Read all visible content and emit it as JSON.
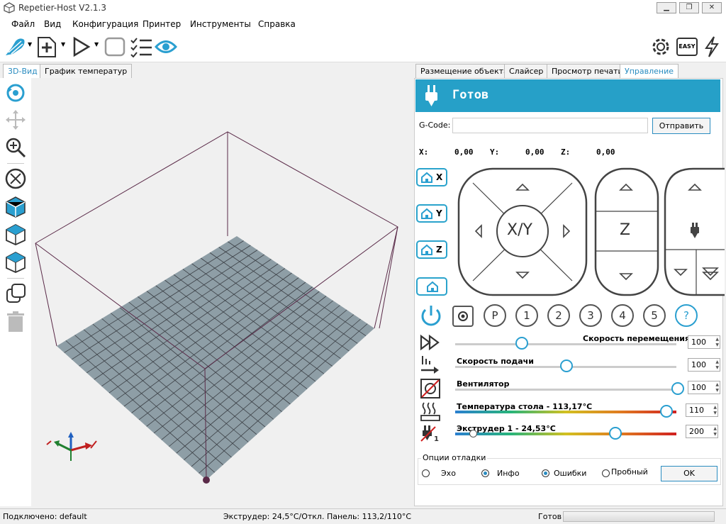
{
  "window": {
    "title": "Repetier-Host V2.1.3",
    "minimize": "▁",
    "maximize": "❐",
    "close": "✕"
  },
  "menu": [
    "Файл",
    "Вид",
    "Конфигурация",
    "Принтер",
    "Инструменты",
    "Справка"
  ],
  "left_tabs": [
    "3D-Вид",
    "График температур"
  ],
  "right_tabs": [
    "Размещение объекта",
    "Слайсер",
    "Просмотр печати",
    "Управление"
  ],
  "toolbar": {
    "easy_label": "EASY"
  },
  "control": {
    "status": "Готов",
    "gcode_label": "G-Code:",
    "gcode_value": "",
    "send_button": "Отправить",
    "coords": {
      "x_label": "X:",
      "x": "0,00",
      "y_label": "Y:",
      "y": "0,00",
      "z_label": "Z:",
      "z": "0,00"
    },
    "home_x": "X",
    "home_y": "Y",
    "home_z": "Z",
    "xy_label": "X/Y",
    "z_label": "Z",
    "presets": [
      "P",
      "1",
      "2",
      "3",
      "4",
      "5",
      "?"
    ]
  },
  "sliders": {
    "move_speed": {
      "label": "Скорость перемещения",
      "value": "100",
      "level": 0.3
    },
    "feed_speed": {
      "label": "Скорость подачи",
      "value": "100",
      "level": 0.5
    },
    "fan": {
      "label": "Вентилятор",
      "value": "100",
      "level": 1.0
    },
    "bed_temp": {
      "label": "Температура стола - 113,17°C",
      "value": "110",
      "level": 0.95
    },
    "extruder": {
      "label": "Экструдер 1 - 24,53°C",
      "value": "200",
      "level": 0.72
    }
  },
  "debug": {
    "title": "Опции отладки",
    "echo": "Эхо",
    "info": "Инфо",
    "errors": "Ошибки",
    "dry_run": "Пробный",
    "ok": "OK"
  },
  "status_bar": {
    "connected": "Подключено: default",
    "temps": "Экструдер: 24,5°C/Откл. Панель: 113,2/110°C",
    "state": "Готов"
  },
  "colors": {
    "accent": "#26a0c8",
    "bed": "#8c9ca4",
    "frame": "#5a2a48"
  }
}
